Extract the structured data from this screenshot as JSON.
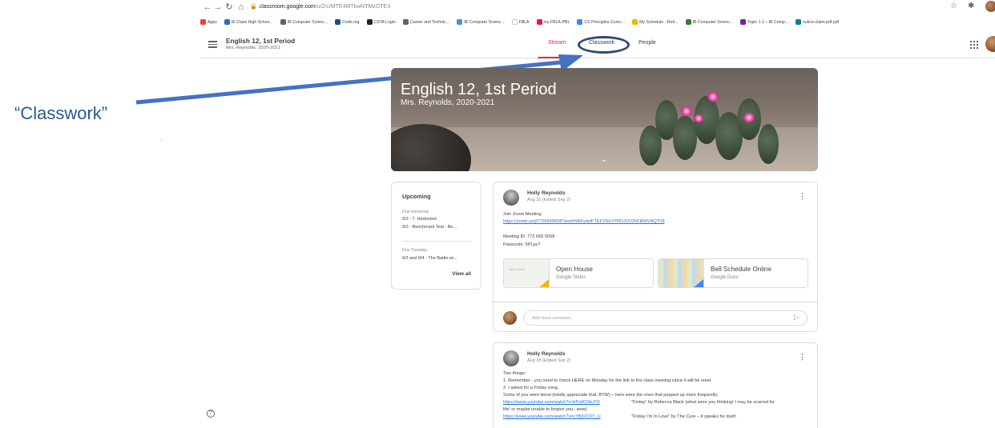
{
  "browser": {
    "url_host": "classroom.google.com",
    "url_path": "/u/2/c/MTE4MTkwNTMzOTE3",
    "bookmarks": [
      {
        "label": "Apps",
        "color": "#ea4335"
      },
      {
        "label": "IE Class High Schoo...",
        "color": "#3367d6"
      },
      {
        "label": "IB Computer Scienc...",
        "color": "#5f6368"
      },
      {
        "label": "Code.org",
        "color": "#1a4f8b"
      },
      {
        "label": "CSTA Login",
        "color": "#202124"
      },
      {
        "label": "Career and Technic...",
        "color": "#5f6368"
      },
      {
        "label": "IB Computer Scienc...",
        "color": "#4a90d9"
      },
      {
        "label": "FBLA",
        "color": "#ffffff"
      },
      {
        "label": "my FBLA-PBL",
        "color": "#d81b60"
      },
      {
        "label": "CS Principles Curric...",
        "color": "#4285f4"
      },
      {
        "label": "My Schedule - Red...",
        "color": "#f4b400"
      },
      {
        "label": "IB Computer Scienc...",
        "color": "#2e7d32"
      },
      {
        "label": "Topic 1.1 – IB Comp...",
        "color": "#7b1fa2"
      },
      {
        "label": "notice-claim.pdf.pdf",
        "color": "#00838f"
      }
    ]
  },
  "appbar": {
    "class_title": "English 12, 1st Period",
    "class_sub": "Mrs. Reynolds, 2020-2021",
    "tabs": {
      "stream": "Stream",
      "classwork": "Classwork",
      "people": "People"
    }
  },
  "annotation": {
    "callout": "“Classwork”",
    "mark": "`"
  },
  "banner": {
    "title": "English 12, 1st Period",
    "subtitle": "Mrs. Reynolds, 2020-2021"
  },
  "upcoming": {
    "title": "Upcoming",
    "groups": [
      {
        "due": "Due tomorrow",
        "items": [
          "9/3 - 7. Hedonism",
          "9/2 - Benchmark Test - Be..."
        ]
      },
      {
        "due": "Due Tuesday",
        "items": [
          "9/3 and 9/4 - The Battle wi..."
        ]
      }
    ],
    "view_all": "View all"
  },
  "posts": [
    {
      "author": "Holly Reynolds",
      "date": "Aug 31 (Edited Sep 2)",
      "lines": [
        "Join Zoom Meeting",
        "https://zoom.us/j/7726665658?pwd=WiFydzlFTEFVNzVYRDJOV2hFRWVNQT09",
        "Meeting ID: 772 666 5658",
        "Passcode: 5PLpv7"
      ],
      "attachments": [
        {
          "name": "Open House",
          "type": "Google Slides",
          "thumb_text": "Open House"
        },
        {
          "name": "Bell Schedule Online",
          "type": "Google Docs"
        }
      ],
      "comment_placeholder": "Add class comment..."
    },
    {
      "author": "Holly Reynolds",
      "date": "Aug 28 (Edited Sep 2)",
      "lines": [
        "Two things:",
        "1. Remember - you need to check HERE on Monday for the link to the class meeting since it will be reset.",
        "2. I asked for a Friday song.",
        "Some of you went literal (totally appreciate that, BTW) – here were the ones that popped up more frequently:",
        "https://www.youtube.com/watch?v=kfVsfOSbJY0",
        "\"Friday\" by Rebecca Black (what were you thinking! I may be scarred for",
        "life! or maybe unable to forgive you...wow)",
        "https://www.youtube.com/watch?v=cYBjVCOT_U",
        "\"Friday I'm In Love\" by The Cure – it speaks for itself."
      ]
    }
  ]
}
